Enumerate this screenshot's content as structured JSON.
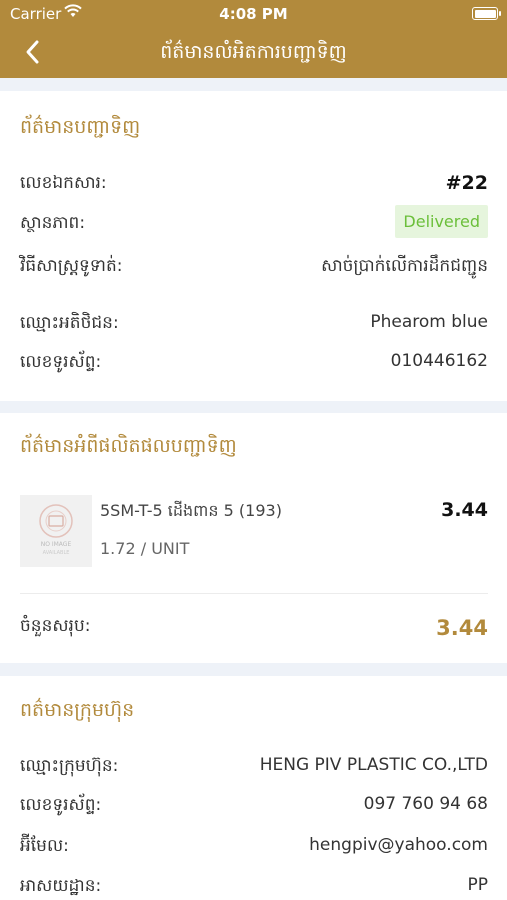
{
  "status_bar": {
    "carrier": "Carrier",
    "time": "4:08 PM"
  },
  "nav": {
    "title": "ព័ត៌មានលំអិតការបញ្ជាទិញ"
  },
  "order_info": {
    "title": "ព័ត៌មានបញ្ជាទិញ",
    "rows": [
      {
        "label": "លេខឯកសារ:",
        "value": "#22"
      },
      {
        "label": "ស្ថានភាព:",
        "value": "Delivered"
      },
      {
        "label": "វិធីសាស្ត្រទូទាត់:",
        "value": "សាច់ប្រាក់លើការដឹកជញ្ជូន"
      },
      {
        "label": "ឈ្មោះអតិថិជន:",
        "value": "Phearom blue"
      },
      {
        "label": "លេខទូរស័ព្ទ:",
        "value": "010446162"
      }
    ]
  },
  "product_info": {
    "title": "ព័ត៌មានអំពីផលិតផលបញ្ជាទិញ",
    "item": {
      "name": "5SM-T-5 ដើងពាន 5 (193)",
      "unit_price": "1.72 / UNIT",
      "amount": "3.44",
      "thumb_text_1": "NO IMAGE",
      "thumb_text_2": "AVAILABLE"
    },
    "total_label": "ចំនួនសរុប:",
    "total_value": "3.44"
  },
  "company_info": {
    "title": "ពត៌មានក្រុមហ៊ុន",
    "rows": [
      {
        "label": "ឈ្មោះក្រុមហ៊ុន:",
        "value": "HENG PIV PLASTIC CO.,LTD"
      },
      {
        "label": "លេខទូរស័ព្ទ:",
        "value": "097 760 94 68"
      },
      {
        "label": "អ៊ីមែល:",
        "value": "hengpiv@yahoo.com"
      },
      {
        "label": "អាសយដ្ឋាន:",
        "value": "PP"
      }
    ]
  },
  "colors": {
    "accent": "#b28a3c",
    "delivered_text": "#6bbf3a",
    "delivered_bg": "#e6f5dd",
    "background": "#eef2f8"
  },
  "icons": {
    "back": "chevron-left-icon",
    "wifi": "wifi-icon",
    "battery": "battery-icon"
  }
}
